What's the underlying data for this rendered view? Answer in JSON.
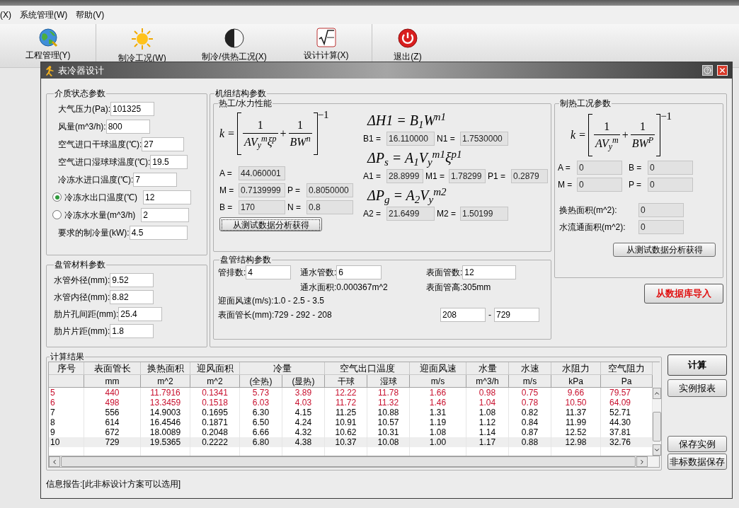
{
  "menu": [
    "(X)",
    "系统管理(W)",
    "帮助(V)"
  ],
  "toolbar": [
    {
      "label": "工程管理(Y)",
      "kind": "globe"
    },
    {
      "label": "制冷工况(W)",
      "kind": "sun"
    },
    {
      "label": "制冷/供热工况(X)",
      "kind": "contrast"
    },
    {
      "label": "设计计算(X)",
      "kind": "formula"
    },
    {
      "label": "退出(Z)",
      "kind": "power"
    }
  ],
  "dialog": {
    "title": "表冷器设计"
  },
  "medium": {
    "title": "介质状态参数",
    "fields": [
      {
        "kind": "text",
        "label": "大气压力(Pa):",
        "value": "101325"
      },
      {
        "kind": "text",
        "label": "风量(m^3/h):",
        "value": "800"
      },
      {
        "kind": "text",
        "label": "空气进口干球温度(℃):",
        "value": "27"
      },
      {
        "kind": "text",
        "label": "空气进口湿球球温度(℃):",
        "value": "19.5"
      },
      {
        "kind": "text",
        "label": "冷冻水进口温度(℃):",
        "value": "7"
      },
      {
        "kind": "radio",
        "selected": true,
        "label": "冷冻水出口温度(℃)",
        "value": "12"
      },
      {
        "kind": "radio",
        "selected": false,
        "label": "冷冻水水量(m^3/h)",
        "value": "2"
      },
      {
        "kind": "text",
        "label": "要求的制冷量(kW):",
        "value": "4.5"
      }
    ]
  },
  "material": {
    "title": "盘管材料参数",
    "fields": [
      {
        "label": "水管外径(mm):",
        "value": "9.52"
      },
      {
        "label": "水管内径(mm):",
        "value": "8.82"
      },
      {
        "label": "肋片孔间距(mm):",
        "value": "25.4"
      },
      {
        "label": "肋片片距(mm):",
        "value": "1.8"
      }
    ]
  },
  "structure": {
    "title": "机组结构参数",
    "thermal": {
      "title": "热工/水力性能",
      "formula": {
        "lhs": "k =",
        "operator": "+",
        "exponent": "−1",
        "terms": [
          {
            "num": "1",
            "den": "AV$_{y}$$^{m}$ξ$^{p}$"
          },
          {
            "num": "1",
            "den": "BW$^{n}$"
          }
        ]
      },
      "params": [
        [
          {
            "label": "A =",
            "value": "44.060001",
            "disabled": true
          }
        ],
        [
          {
            "label": "M =",
            "value": "0.7139999",
            "disabled": true
          },
          {
            "label": "P =",
            "value": "0.8050000",
            "disabled": true
          }
        ],
        [
          {
            "label": "B =",
            "value": "170",
            "disabled": true
          },
          {
            "label": "N =",
            "value": "0.8",
            "disabled": true
          }
        ]
      ],
      "button": {
        "label": "从测试数据分析获得",
        "focused": true
      },
      "resistance": [
        {
          "formula": "ΔH1 = B$_{1}$W$^{n1}$",
          "params": [
            {
              "label": "B1 =",
              "value": "16.110000",
              "disabled": true
            },
            {
              "label": "N1 =",
              "value": "1.7530000",
              "disabled": true
            }
          ]
        },
        {
          "formula": "ΔP$_{s}$ = A$_{1}$V$_{y}$$^{m1}$ξ$^{p1}$",
          "params": [
            {
              "label": "A1 =",
              "value": "28.8999",
              "disabled": true
            },
            {
              "label": "M1 =",
              "value": "1.78299",
              "disabled": true
            },
            {
              "label": "P1 =",
              "value": "0.2879",
              "disabled": true
            }
          ]
        },
        {
          "formula": "ΔP$_{g}$ = A$_{2}$V$_{y}$$^{m2}$",
          "params": [
            {
              "label": "A2 =",
              "value": "21.6499",
              "disabled": true
            },
            {
              "label": "M2 =",
              "value": "1.50199",
              "disabled": true
            }
          ]
        }
      ]
    },
    "coil": {
      "title": "盘管结构参数",
      "fields": [
        {
          "label": "管排数:",
          "value": "4"
        },
        {
          "label": "通水管数:",
          "value": "6"
        },
        {
          "label": "表面管数:",
          "value": "12"
        }
      ],
      "notes": [
        "通水面积:0.000367m^2",
        "表面管高:305mm"
      ],
      "air_speed": "迎面风速(m/s):1.0 - 2.5 - 3.5",
      "tube_length": "表面管长(mm):729 - 292 - 208",
      "range": {
        "from": "208",
        "separator": "-",
        "to": "729"
      }
    },
    "heating": {
      "title": "制热工况参数",
      "formula": {
        "lhs": "k =",
        "operator": "+",
        "exponent": "−1",
        "terms": [
          {
            "num": "1",
            "den": "AV$_{y}$$^{m}$"
          },
          {
            "num": "1",
            "den": "BW$^{P}$"
          }
        ]
      },
      "params": [
        [
          {
            "label": "A =",
            "value": "0",
            "disabled": true
          },
          {
            "label": "B =",
            "value": "0",
            "disabled": true
          }
        ],
        [
          {
            "label": "M =",
            "value": "0",
            "disabled": true
          },
          {
            "label": "P =",
            "value": "0",
            "disabled": true
          }
        ]
      ],
      "areas": [
        {
          "label": "换热面积(m^2):",
          "value": "0",
          "disabled": true
        },
        {
          "label": "水流通面积(m^2):",
          "value": "0",
          "disabled": true
        }
      ],
      "button": {
        "label": "从测试数据分析获得",
        "focused": false
      }
    },
    "import_button": "从数据库导入"
  },
  "results": {
    "title": "计算结果",
    "header": [
      {
        "label": "序号"
      },
      {
        "label": "表面管长",
        "subheads": [
          "mm"
        ]
      },
      {
        "label": "换热面积",
        "subheads": [
          "m^2"
        ]
      },
      {
        "label": "迎风面积",
        "subheads": [
          "m^2"
        ]
      },
      {
        "label": "冷量",
        "subheads": [
          "(全热)",
          "(显热)"
        ]
      },
      {
        "label": "空气出口温度",
        "subheads": [
          "干球",
          "湿球"
        ]
      },
      {
        "label": "迎面风速",
        "subheads": [
          "m/s"
        ]
      },
      {
        "label": "水量",
        "subheads": [
          "m^3/h"
        ]
      },
      {
        "label": "水速",
        "subheads": [
          "m/s"
        ]
      },
      {
        "label": "水阻力",
        "subheads": [
          "kPa"
        ]
      },
      {
        "label": "空气阻力",
        "subheads": [
          "Pa"
        ]
      }
    ],
    "rows": [
      {
        "color": "#c8102e",
        "selected": false,
        "cells": [
          "5",
          "440",
          "11.7916",
          "0.1341",
          "5.73",
          "3.89",
          "12.22",
          "11.78",
          "1.66",
          "0.98",
          "0.75",
          "9.66",
          "79.57"
        ]
      },
      {
        "color": "#c8102e",
        "selected": false,
        "cells": [
          "6",
          "498",
          "13.3459",
          "0.1518",
          "6.03",
          "4.03",
          "11.72",
          "11.32",
          "1.46",
          "1.04",
          "0.78",
          "10.50",
          "64.09"
        ]
      },
      {
        "color": "#000000",
        "selected": false,
        "cells": [
          "7",
          "556",
          "14.9003",
          "0.1695",
          "6.30",
          "4.15",
          "11.25",
          "10.88",
          "1.31",
          "1.08",
          "0.82",
          "11.37",
          "52.71"
        ]
      },
      {
        "color": "#000000",
        "selected": false,
        "cells": [
          "8",
          "614",
          "16.4546",
          "0.1871",
          "6.50",
          "4.24",
          "10.91",
          "10.57",
          "1.19",
          "1.12",
          "0.84",
          "11.99",
          "44.30"
        ]
      },
      {
        "color": "#000000",
        "selected": false,
        "cells": [
          "9",
          "672",
          "18.0089",
          "0.2048",
          "6.66",
          "4.32",
          "10.62",
          "10.31",
          "1.08",
          "1.14",
          "0.87",
          "12.52",
          "37.81"
        ]
      },
      {
        "color": "#000000",
        "selected": true,
        "cells": [
          "10",
          "729",
          "19.5365",
          "0.2222",
          "6.80",
          "4.38",
          "10.37",
          "10.08",
          "1.00",
          "1.17",
          "0.88",
          "12.98",
          "32.76"
        ]
      }
    ]
  },
  "side_buttons": [
    {
      "label": "计算",
      "default": true
    },
    {
      "label": "实例报表",
      "default": false
    },
    {
      "label": "保存实例",
      "default": false
    },
    {
      "label": "非标数据保存",
      "default": false
    }
  ],
  "status": "信息报告:[此非标设计方案可以选用]"
}
